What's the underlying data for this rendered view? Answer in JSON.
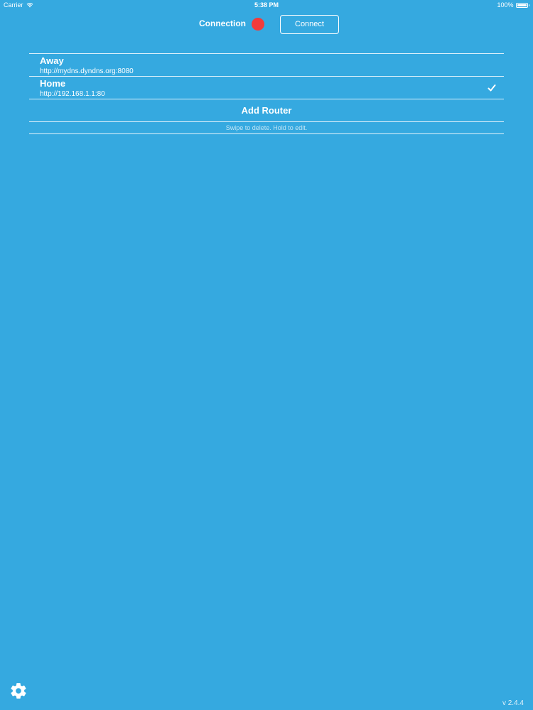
{
  "status_bar": {
    "carrier": "Carrier",
    "time": "5:38 PM",
    "battery": "100%",
    "battery_level": 1.0,
    "wifi_icon": "wifi-icon",
    "battery_icon": "battery-icon"
  },
  "header": {
    "connection_label": "Connection",
    "connection_status_color": "#f23b3b",
    "connect_button_label": "Connect"
  },
  "routers": [
    {
      "name": "Away",
      "url": "http://mydns.dyndns.org:8080",
      "selected": false
    },
    {
      "name": "Home",
      "url": "http://192.168.1.1:80",
      "selected": true
    }
  ],
  "list_actions": {
    "add_router_label": "Add Router",
    "hint": "Swipe to delete. Hold to edit."
  },
  "footer": {
    "settings_icon": "gear-icon",
    "version": "v 2.4.4"
  },
  "colors": {
    "background": "#35a9e0",
    "foreground": "#ffffff",
    "status_dot": "#f23b3b"
  }
}
